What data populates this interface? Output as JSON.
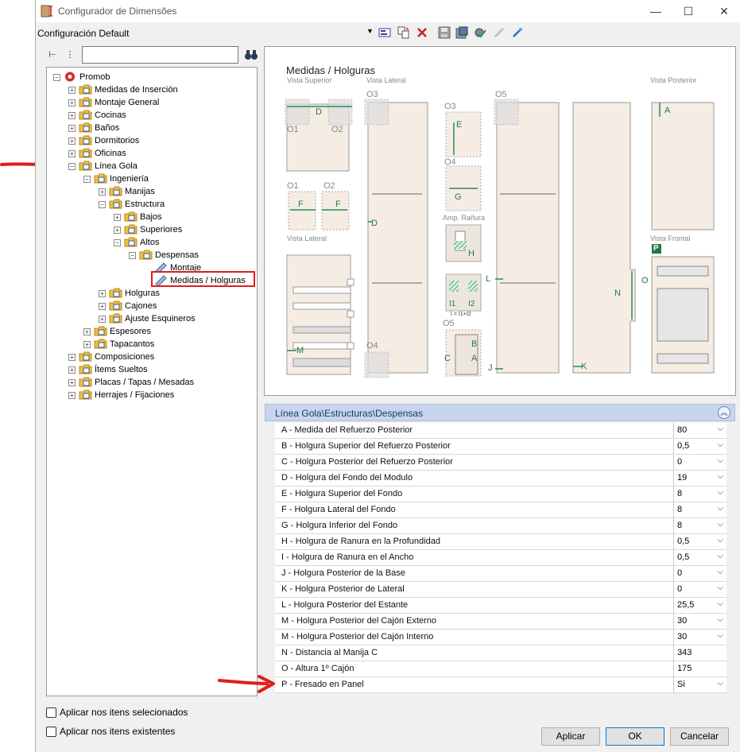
{
  "window": {
    "title": "Configurador de Dimensões",
    "minimize": "—",
    "maximize": "☐",
    "close": "✕"
  },
  "config": {
    "selected": "Configuración Default"
  },
  "tree": [
    {
      "label": "Promob",
      "level": 0,
      "exp": "−"
    },
    {
      "label": "Medidas de Inserción",
      "level": 1,
      "exp": "+"
    },
    {
      "label": "Montaje General",
      "level": 1,
      "exp": "+"
    },
    {
      "label": "Cocinas",
      "level": 1,
      "exp": "+"
    },
    {
      "label": "Baños",
      "level": 1,
      "exp": "+"
    },
    {
      "label": "Dormitorios",
      "level": 1,
      "exp": "+"
    },
    {
      "label": "Oficinas",
      "level": 1,
      "exp": "+"
    },
    {
      "label": "Línea Gola",
      "level": 1,
      "exp": "−"
    },
    {
      "label": "Ingeniería",
      "level": 2,
      "exp": "−"
    },
    {
      "label": "Manijas",
      "level": 3,
      "exp": "+"
    },
    {
      "label": "Estructura",
      "level": 3,
      "exp": "−"
    },
    {
      "label": "Bajos",
      "level": 4,
      "exp": "+"
    },
    {
      "label": "Superiores",
      "level": 4,
      "exp": "+"
    },
    {
      "label": "Altos",
      "level": 4,
      "exp": "−"
    },
    {
      "label": "Despensas",
      "level": 5,
      "exp": "−"
    },
    {
      "label": "Montaje",
      "level": 6,
      "exp": ""
    },
    {
      "label": "Medidas / Holguras",
      "level": 6,
      "exp": ""
    },
    {
      "label": "Holguras",
      "level": 3,
      "exp": "+"
    },
    {
      "label": "Cajones",
      "level": 3,
      "exp": "+"
    },
    {
      "label": "Ajuste Esquineros",
      "level": 3,
      "exp": "+"
    },
    {
      "label": "Espesores",
      "level": 2,
      "exp": "+"
    },
    {
      "label": "Tapacantos",
      "level": 2,
      "exp": "+"
    },
    {
      "label": "Composiciones",
      "level": 1,
      "exp": "+"
    },
    {
      "label": "Ítems Sueltos",
      "level": 1,
      "exp": "+"
    },
    {
      "label": "Placas / Tapas / Mesadas",
      "level": 1,
      "exp": "+"
    },
    {
      "label": "Herrajes / Fijaciones",
      "level": 1,
      "exp": "+"
    }
  ],
  "preview": {
    "title": "Medidas / Holguras",
    "labels": {
      "vista_superior": "Vista Superior",
      "vista_lateral": "Vista Lateral",
      "vista_lateral2": "Vista Lateral",
      "vista_posterior": "Vista Posterior",
      "vista_frontal": "Vista Frontal",
      "amp_ranura": "Amp. Rañura",
      "o1": "O1",
      "o2": "O2",
      "o3": "O3",
      "o4": "O4",
      "o5": "O5",
      "o1b": "O1",
      "o2b": "O2",
      "o3b": "O3",
      "o4b": "O4",
      "o5b": "O5",
      "A": "A",
      "A2": "A",
      "B": "B",
      "C": "C",
      "D": "D",
      "D2": "D",
      "E": "E",
      "F": "F",
      "F2": "F",
      "G": "G",
      "H": "H",
      "I1": "I1",
      "I2": "I2",
      "I_formula": "I = I1+I2",
      "J": "J",
      "K": "K",
      "L": "L",
      "M": "M",
      "N": "N",
      "O": "O",
      "P": "P"
    }
  },
  "props": {
    "header": "Línea Gola\\Estructuras\\Despensas",
    "rows": [
      {
        "name": "A - Medida del Refuerzo Posterior",
        "value": "80",
        "dd": true
      },
      {
        "name": "B - Holgura Superior del Refuerzo Posterior",
        "value": "0,5",
        "dd": true
      },
      {
        "name": "C - Holgura Posterior del Refuerzo Posterior",
        "value": "0",
        "dd": true
      },
      {
        "name": "D - Holgura del Fondo del Modulo",
        "value": "19",
        "dd": true
      },
      {
        "name": "E - Holgura Superior del Fondo",
        "value": "8",
        "dd": true
      },
      {
        "name": "F - Holgura Lateral del Fondo",
        "value": "8",
        "dd": true
      },
      {
        "name": "G - Holgura Inferior del Fondo",
        "value": "8",
        "dd": true
      },
      {
        "name": "H - Holgura de Ranura en la Profundidad",
        "value": "0,5",
        "dd": true
      },
      {
        "name": "I - Holgura de Ranura en el Ancho",
        "value": "0,5",
        "dd": true
      },
      {
        "name": "J - Holgura Posterior de la Base",
        "value": "0",
        "dd": true
      },
      {
        "name": "K - Holgura Posterior de Lateral",
        "value": "0",
        "dd": true
      },
      {
        "name": "L - Holgura Posterior del Estante",
        "value": "25,5",
        "dd": true
      },
      {
        "name": "M - Holgura Posterior del Cajón Externo",
        "value": "30",
        "dd": true
      },
      {
        "name": "M - Holgura Posterior del Cajón Interno",
        "value": "30",
        "dd": true
      },
      {
        "name": "N - Distancia al Manija C",
        "value": "343",
        "dd": false
      },
      {
        "name": "O - Altura 1º Cajón",
        "value": "175",
        "dd": false
      },
      {
        "name": "P - Fresado en Panel",
        "value": "Si",
        "dd": true
      }
    ]
  },
  "options": {
    "apply_selected": "Aplicar nos itens selecionados",
    "apply_existing": "Aplicar nos itens existentes"
  },
  "buttons": {
    "apply": "Aplicar",
    "ok": "OK",
    "cancel": "Cancelar"
  },
  "colors": {
    "accent_green": "#2a8a5a",
    "folder": "#f0c040",
    "highlight_red": "#e01c1c",
    "header_blue": "#c7d6ec"
  }
}
